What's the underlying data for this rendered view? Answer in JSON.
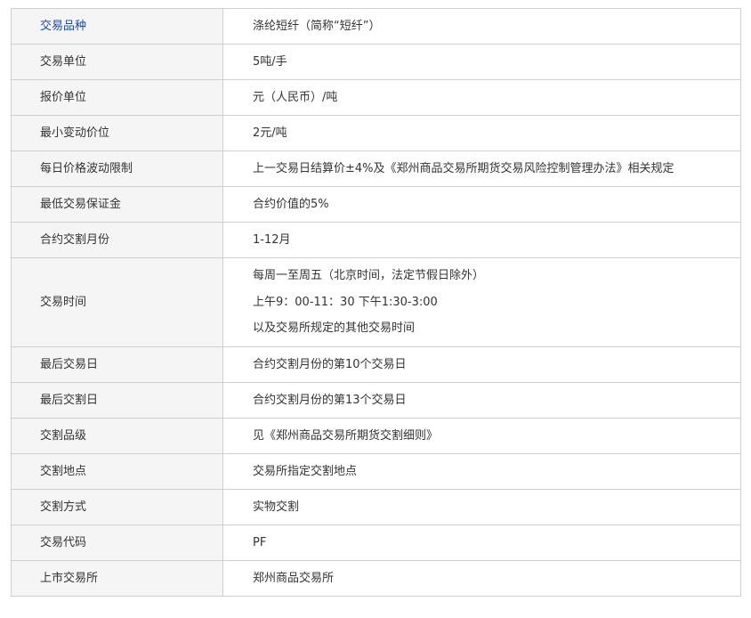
{
  "rows": [
    {
      "label": "交易品种",
      "values": [
        "涤纶短纤（简称“短纤”）"
      ]
    },
    {
      "label": "交易单位",
      "values": [
        "5吨/手"
      ]
    },
    {
      "label": "报价单位",
      "values": [
        "元（人民币）/吨"
      ]
    },
    {
      "label": "最小变动价位",
      "values": [
        "2元/吨"
      ]
    },
    {
      "label": "每日价格波动限制",
      "values": [
        "上一交易日结算价±4%及《郑州商品交易所期货交易风险控制管理办法》相关规定"
      ]
    },
    {
      "label": "最低交易保证金",
      "values": [
        "合约价值的5%"
      ]
    },
    {
      "label": "合约交割月份",
      "values": [
        "1-12月"
      ]
    },
    {
      "label": "交易时间",
      "values": [
        "每周一至周五（北京时间，法定节假日除外）",
        "上午9：00-11：30  下午1:30-3:00",
        "以及交易所规定的其他交易时间"
      ]
    },
    {
      "label": "最后交易日",
      "values": [
        "合约交割月份的第10个交易日"
      ]
    },
    {
      "label": "最后交割日",
      "values": [
        "合约交割月份的第13个交易日"
      ]
    },
    {
      "label": "交割品级",
      "values": [
        "见《郑州商品交易所期货交割细则》"
      ]
    },
    {
      "label": "交割地点",
      "values": [
        "交易所指定交割地点"
      ]
    },
    {
      "label": "交割方式",
      "values": [
        "实物交割"
      ]
    },
    {
      "label": "交易代码",
      "values": [
        "PF"
      ]
    },
    {
      "label": "上市交易所",
      "values": [
        "郑州商品交易所"
      ]
    }
  ],
  "colors": {
    "header_label": "#1a4b9c",
    "border": "#cfcfcf",
    "label_bg": "#f5f5f5",
    "text": "#333333"
  }
}
